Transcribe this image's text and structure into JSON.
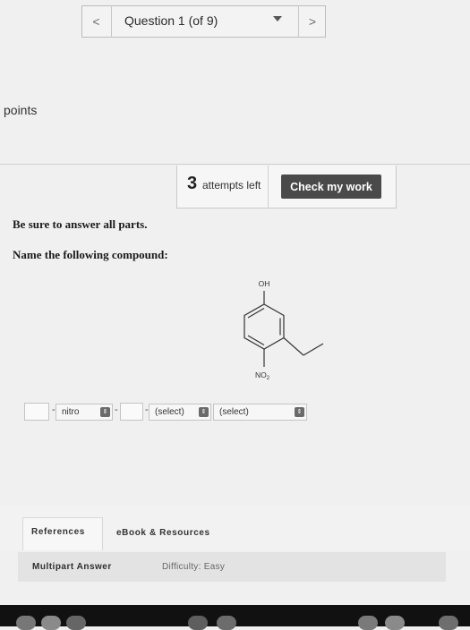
{
  "nav": {
    "prev": "<",
    "title": "Question 1 (of 9)",
    "next": ">"
  },
  "points_label": "points",
  "attempts": {
    "count": "3",
    "text": "attempts left",
    "check_label": "Check my work"
  },
  "instructions": {
    "line1": "Be sure to answer all parts.",
    "line2": "Name the following compound:"
  },
  "molecule": {
    "oh_label": "OH",
    "no2_label": "NO",
    "no2_sub": "2"
  },
  "answer": {
    "dash": "-",
    "nitro_label": "nitro",
    "select1": "(select)",
    "select2": "(select)"
  },
  "tabs": {
    "references": "References",
    "ebook": "eBook & Resources"
  },
  "footer": {
    "multipart": "Multipart Answer",
    "difficulty": "Difficulty: Easy"
  }
}
